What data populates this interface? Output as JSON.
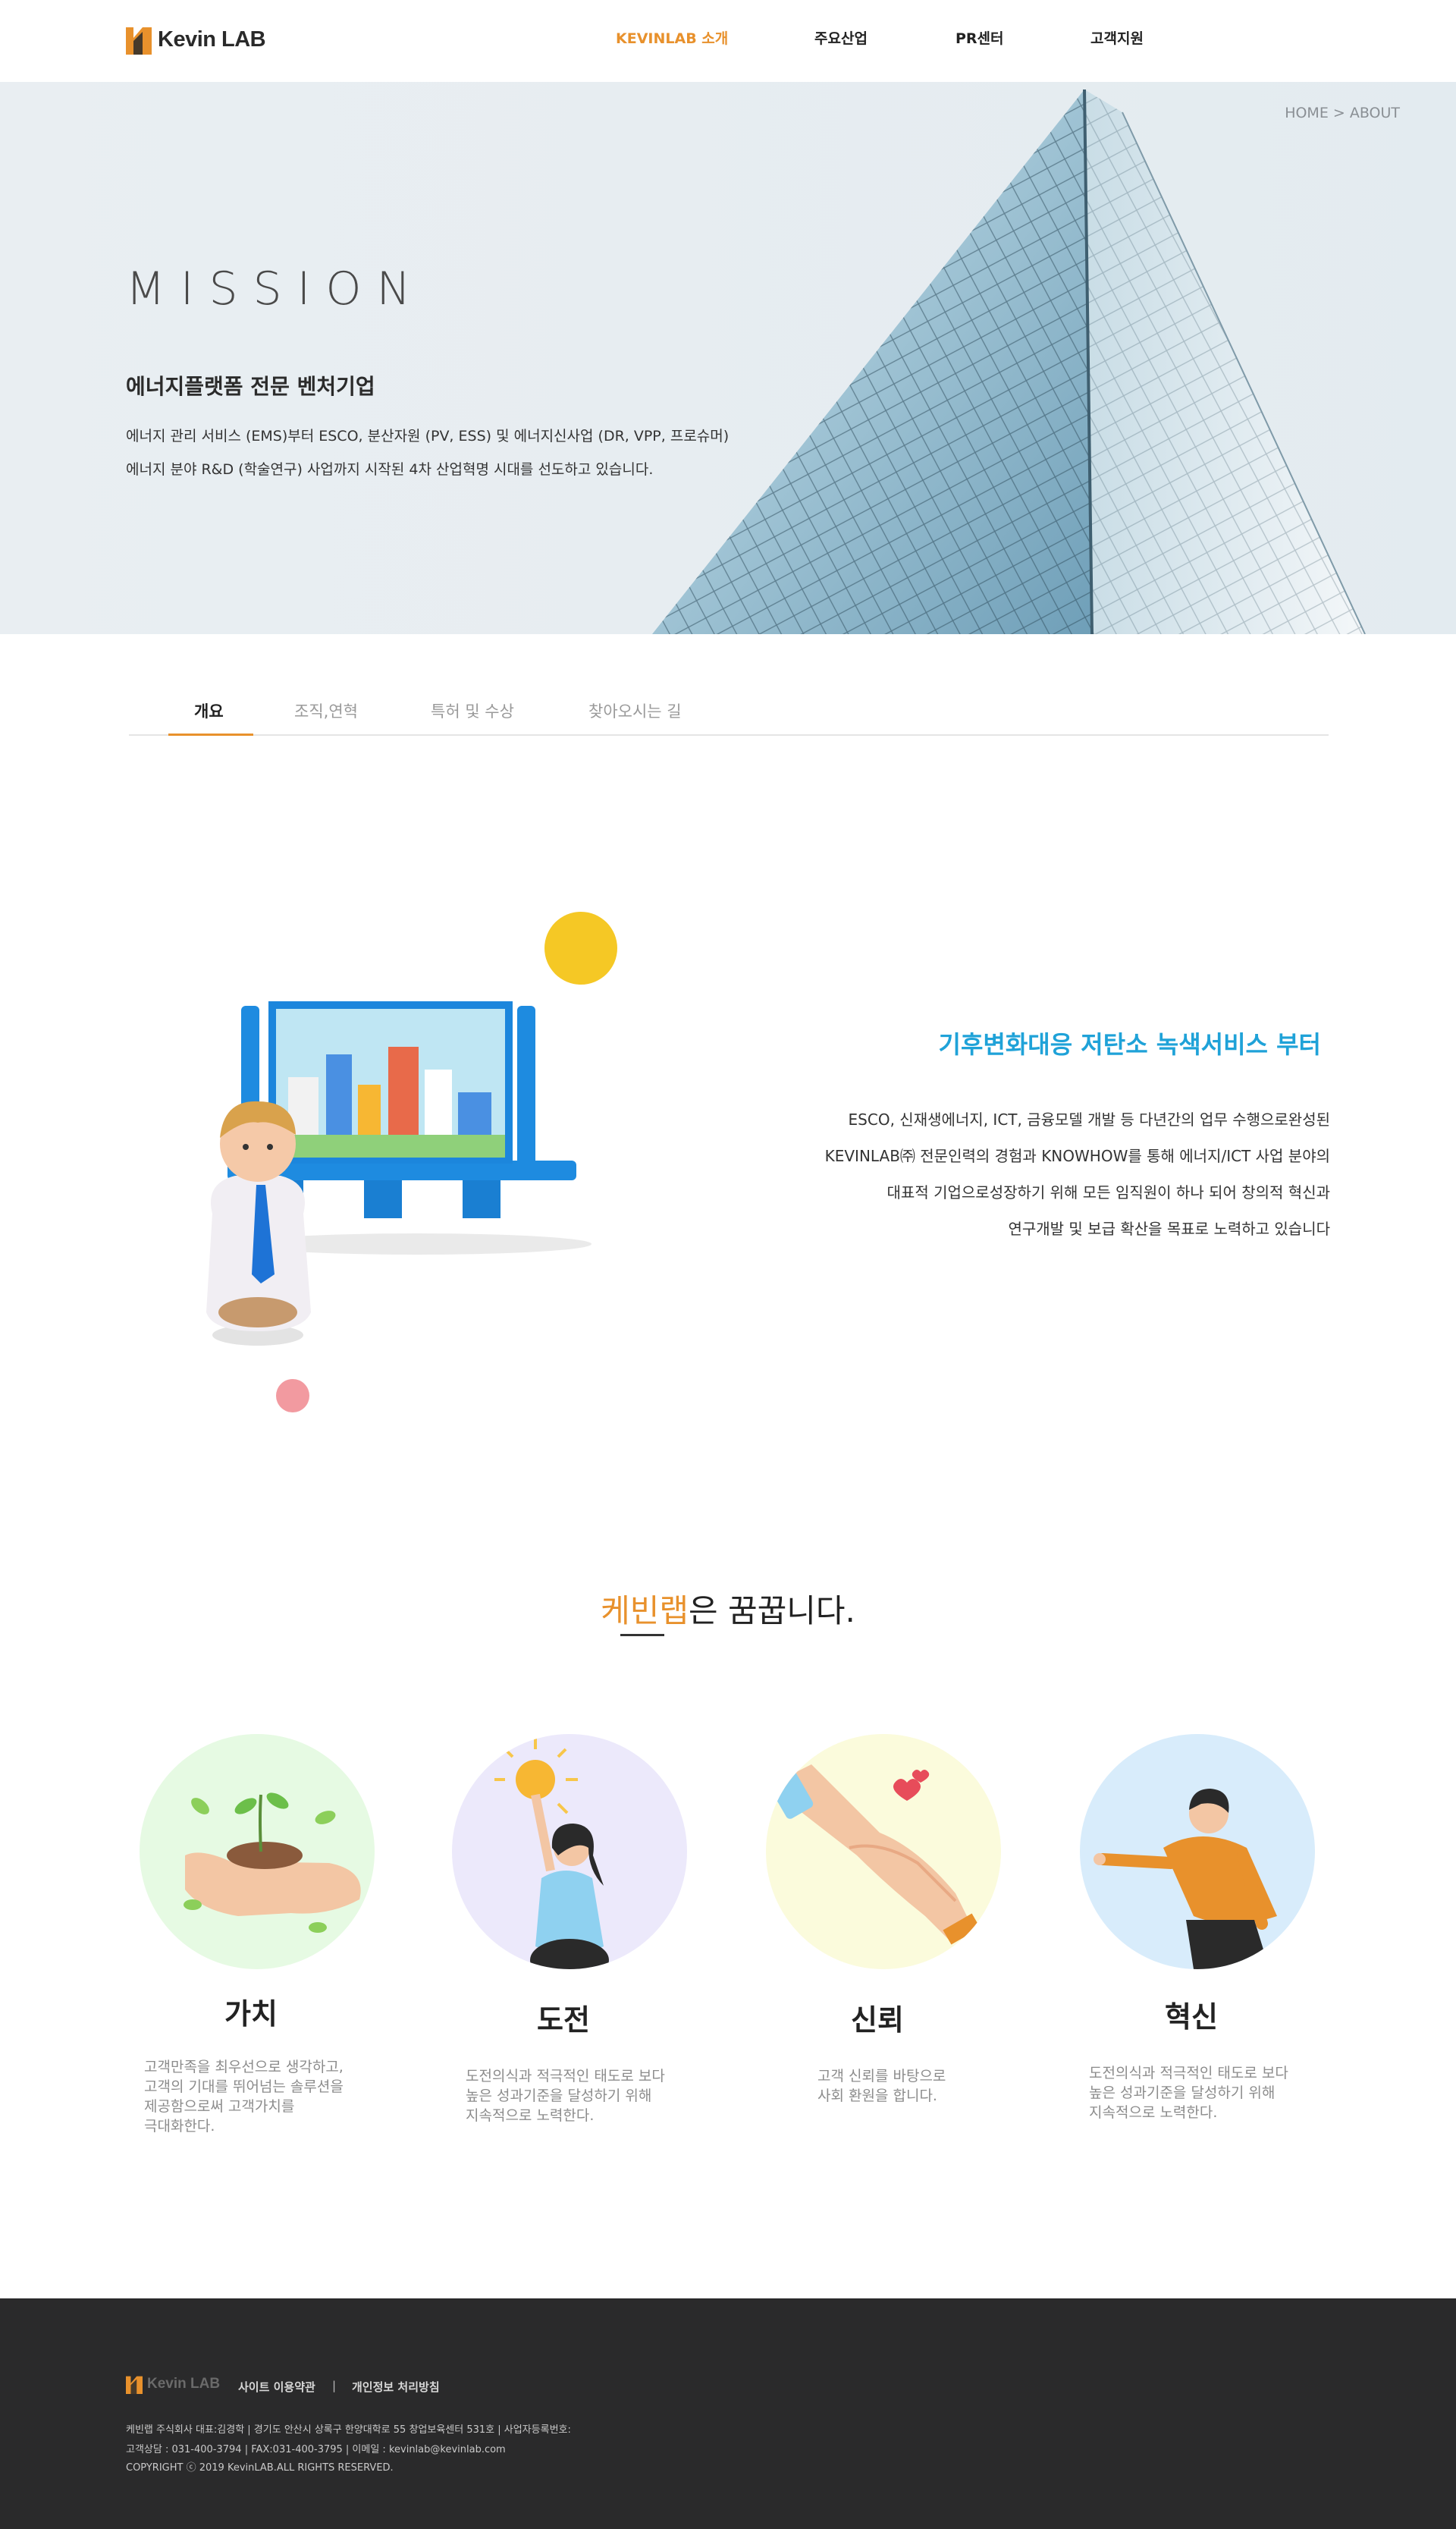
{
  "header": {
    "logo_text": "Kevin LAB",
    "nav": [
      {
        "label": "KEVINLAB 소개",
        "active": true
      },
      {
        "label": "주요산업"
      },
      {
        "label": "PR센터"
      },
      {
        "label": "고객지원"
      }
    ]
  },
  "hero": {
    "breadcrumb": "HOME  > ABOUT",
    "title": "MISSION",
    "subtitle": "에너지플랫폼 전문 벤처기업",
    "desc_lines": [
      "에너지 관리 서비스 (EMS)부터 ESCO, 분산자원 (PV, ESS) 및 에너지신사업 (DR, VPP, 프로슈머)",
      "에너지 분야 R&D (학술연구) 사업까지 시작된 4차 산업혁명 시대를 선도하고 있습니다."
    ]
  },
  "tabs": [
    {
      "label": "개요",
      "active": true
    },
    {
      "label": "조직,연혁"
    },
    {
      "label": "특허 및 수상"
    },
    {
      "label": "찾아오시는 길"
    }
  ],
  "intro": {
    "heading": "기후변화대응 저탄소 녹색서비스 부터",
    "lines": [
      "ESCO, 신재생에너지, ICT, 금융모델 개발 등 다년간의 업무 수행으로완성된",
      "KEVINLAB㈜ 전문인력의 경험과 KNOWHOW를 통해 에너지/ICT 사업 분야의",
      "대표적 기업으로성장하기 위해 모든 임직원이 하나 되어 창의적 혁신과",
      "연구개발 및 보급 확산을 목표로 노력하고 있습니다"
    ]
  },
  "dream": {
    "title_highlight": "케빈랩",
    "title_rest": "은 꿈꿉니다."
  },
  "values": [
    {
      "title": "가치",
      "icon": "plant-in-hand-icon",
      "bg": "#e6fae3",
      "desc": [
        "고객만족을 최우선으로 생각하고,",
        "고객의 기대를 뛰어넘는 솔루션을",
        "제공함으로써 고객가치를",
        "극대화한다."
      ]
    },
    {
      "title": "도전",
      "icon": "woman-reaching-sun-icon",
      "bg": "#ece9fb",
      "desc": [
        "도전의식과 적극적인 태도로 보다",
        "높은 성과기준을 달성하기 위해",
        "지속적으로 노력한다."
      ]
    },
    {
      "title": "신뢰",
      "icon": "handshake-icon",
      "bg": "#fbfbdc",
      "desc": [
        "고객 신뢰를 바탕으로",
        "사회 환원을 합니다."
      ]
    },
    {
      "title": "혁신",
      "icon": "man-presenting-icon",
      "bg": "#d8ecfb",
      "desc": [
        "도전의식과 적극적인 태도로 보다",
        "높은 성과기준을 달성하기 위해",
        "지속적으로 노력한다."
      ]
    }
  ],
  "footer": {
    "logo_text": "Kevin LAB",
    "links": [
      "사이트 이용약관",
      "개인정보 처리방침"
    ],
    "info_lines": [
      "케빈랩 주식회사 대표:김경학     |     경기도 안산시 상록구 한양대학로 55 창업보육센터 531호     |     사업자등록번호:",
      "고객상담 : 031-400-3794     |     FAX:031-400-3795     |     이메일 : kevinlab@kevinlab.com",
      "COPYRIGHT ⓒ 2019 KevinLAB.ALL RIGHTS RESERVED."
    ]
  },
  "colors": {
    "accent": "#e8912c",
    "heading_blue": "#1fa2d8",
    "footer_bg": "#2a2a2b"
  }
}
